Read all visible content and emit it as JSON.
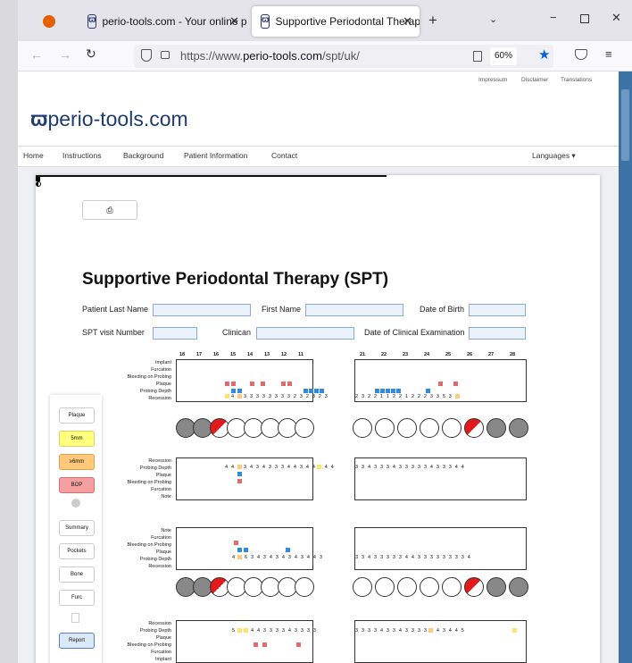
{
  "browser": {
    "tabs": [
      {
        "title": "perio-tools.com - Your online p",
        "icon": "perio-tools-favicon"
      },
      {
        "title": "Supportive Periodontal Therapy (",
        "icon": "perio-tools-favicon"
      }
    ],
    "url_prefix": "https://www.",
    "url_domain": "perio-tools.com",
    "url_path": "/spt/uk/",
    "zoom": "60%"
  },
  "site": {
    "top_links": [
      "Impressum",
      "Disclaimer",
      "Translations"
    ],
    "logo": "perio-tools.com",
    "nav": [
      "Home",
      "Instructions",
      "Background",
      "Patient Information",
      "Contact"
    ],
    "languages": "Languages ▾",
    "title": "Supportive Periodontal Therapy (SPT)",
    "form": {
      "last_name": "Patient Last Name",
      "first_name": "First Name",
      "dob": "Date of Birth",
      "visit": "SPT visit Number",
      "clinician": "Clinican",
      "exam_date": "Date of Clinical Examination"
    },
    "sidebar": [
      "Plaque",
      "5mm",
      "≥6mm",
      "BOP",
      "Summary",
      "Pockets",
      "Bone",
      "Furc",
      "Report"
    ],
    "upper_teeth": [
      "18",
      "17",
      "16",
      "15",
      "14",
      "13",
      "12",
      "11",
      "21",
      "22",
      "23",
      "24",
      "25",
      "26",
      "27",
      "28"
    ],
    "upper_rows_buccal": [
      "Implant",
      "Furcation",
      "Bleeding on Probing",
      "Plaque",
      "Probing Depth",
      "Recession"
    ],
    "upper_rows_palatal": [
      "Recession",
      "Probing Depth",
      "Plaque",
      "Bleeding on Probing",
      "Furcation",
      "Note"
    ],
    "lower_rows_lingual": [
      "Note",
      "Furcation",
      "Bleeding on Probing",
      "Plaque",
      "Probing Depth",
      "Recession"
    ],
    "lower_rows_buccal": [
      "Recession",
      "Probing Depth",
      "Plaque",
      "Bleeding on Probing",
      "Furcation",
      "Implant"
    ],
    "upper_pd_right": "5 4 3  3 3 3 3 3 3 3 3 2 3 2 3 2 3",
    "upper_pd_left": "2 3 2 2 1 1 2 2 1 2 2 2 3 3 5 3 4",
    "palatal_pd_right": "4 4 6 3 4 3 4 3 3 3 4 4 3 4 4 5 4 4",
    "palatal_pd_left": "3 3 4 3 3 3 4 3 3 3 3 3 4 3 3 3 4 4",
    "lower_pd_right": "4 4 6 3 4 3 4 3 4 3 4 3 4 4 3",
    "lower_pd_left": "3 3 4 3 3 3 3 3 4 4 3 3 3 3 3 3 3 3 4",
    "lower_b_pd_right": "5 5 4 4 4 3 3 3 3 4 3 3 3 3",
    "lower_b_pd_left": "3 3 3 3 4 3 3 4 3 3 3 3 4 4 3 4 4 5"
  }
}
